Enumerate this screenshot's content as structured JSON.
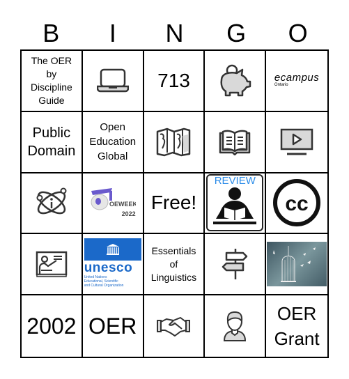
{
  "header": {
    "letters": [
      "B",
      "I",
      "N",
      "G",
      "O"
    ]
  },
  "cells": {
    "r1c1": {
      "type": "text",
      "text": "The OER by Discipline Guide",
      "lines": [
        "The OER",
        "by",
        "Discipline",
        "Guide"
      ]
    },
    "r1c2": {
      "type": "icon",
      "icon": "laptop-icon"
    },
    "r1c3": {
      "type": "text",
      "text": "713"
    },
    "r1c4": {
      "type": "icon",
      "icon": "piggy-bank-icon"
    },
    "r1c5": {
      "type": "logo",
      "logo": "ecampus-ontario-logo",
      "line1": "ecampus",
      "line2": "Ontario"
    },
    "r2c1": {
      "type": "text",
      "lines": [
        "Public",
        "Domain"
      ]
    },
    "r2c2": {
      "type": "text",
      "lines": [
        "Open",
        "Education",
        "Global"
      ]
    },
    "r2c3": {
      "type": "icon",
      "icon": "world-map-icon"
    },
    "r2c4": {
      "type": "icon",
      "icon": "open-book-icon"
    },
    "r2c5": {
      "type": "icon",
      "icon": "video-play-icon"
    },
    "r3c1": {
      "type": "icon",
      "icon": "atom-info-icon"
    },
    "r3c2": {
      "type": "logo",
      "logo": "oeweek-2022-logo",
      "line1": "OEWEEK",
      "line2": "2022"
    },
    "r3c3": {
      "type": "text",
      "text": "Free!"
    },
    "r3c4": {
      "type": "icon",
      "icon": "review-reader-icon",
      "label": "REVIEW"
    },
    "r3c5": {
      "type": "icon",
      "icon": "creative-commons-icon",
      "label": "cc"
    },
    "r4c1": {
      "type": "icon",
      "icon": "teacher-board-icon"
    },
    "r4c2": {
      "type": "logo",
      "logo": "unesco-logo",
      "word": "unesco",
      "sub": [
        "United Nations",
        "Educational, Scientific",
        "and Cultural Organization"
      ]
    },
    "r4c3": {
      "type": "text",
      "lines": [
        "Essentials",
        "of",
        "Linguistics"
      ]
    },
    "r4c4": {
      "type": "icon",
      "icon": "signpost-icon"
    },
    "r4c5": {
      "type": "image",
      "image": "birdcage-photo"
    },
    "r5c1": {
      "type": "text",
      "text": "2002"
    },
    "r5c2": {
      "type": "text",
      "text": "OER"
    },
    "r5c3": {
      "type": "icon",
      "icon": "handshake-icon"
    },
    "r5c4": {
      "type": "icon",
      "icon": "person-icon"
    },
    "r5c5": {
      "type": "text",
      "lines": [
        "OER",
        "Grant"
      ]
    }
  },
  "colors": {
    "grid": "#000000",
    "icon_fill": "#d9d9d9",
    "unesco_blue": "#1b69c9",
    "review_blue": "#2a8be8",
    "oeweek_purple": "#6a5acd"
  }
}
